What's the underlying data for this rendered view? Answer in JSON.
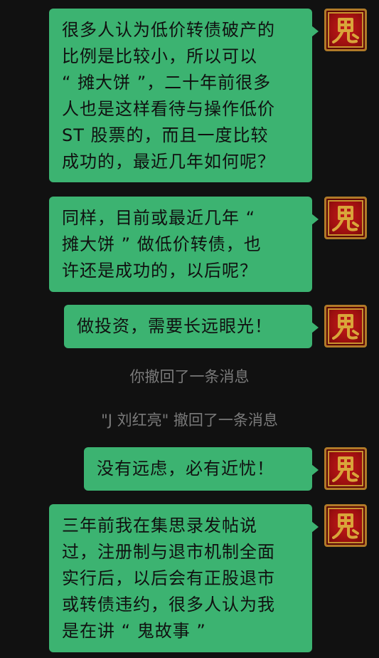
{
  "messages": [
    {
      "text": "很多人认为低价转债破产的\n比例是比较小，所以可以\n“ 摊大饼 ”，二十年前很多\n人也是这样看待与操作低价\nST 股票的，而且一度比较\n成功的，最近几年如何呢？"
    },
    {
      "text": "同样，目前或最近几年 “\n摊大饼 ” 做低价转债，也\n许还是成功的，以后呢？"
    },
    {
      "text": "做投资，需要长远眼光！"
    },
    {
      "text": "没有远虑，必有近忧！"
    },
    {
      "text": "三年前我在集思录发帖说\n过，注册制与退市机制全面\n实行后，以后会有正股退市\n或转债违约，很多人认为我\n是在讲 “ 鬼故事 ”"
    }
  ],
  "system_notices": [
    "你撤回了一条消息",
    "\"J 刘红亮\" 撤回了一条消息"
  ],
  "avatar": {
    "icon": "ghost-seal-icon",
    "bg_color": "#b01414",
    "glyph_color": "#d9a53a"
  },
  "colors": {
    "bubble": "#3cb371",
    "background": "#111111",
    "notice_text": "#7a7a7a"
  }
}
